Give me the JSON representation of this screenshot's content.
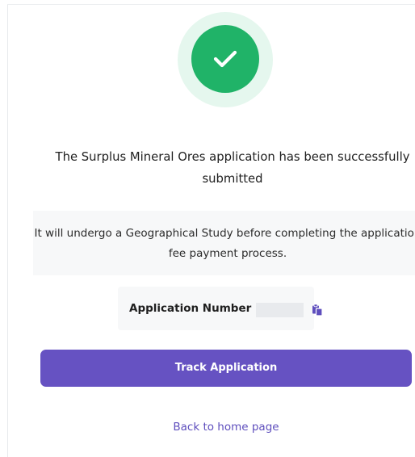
{
  "status_icon": {
    "icon": "check-circle-icon",
    "ring_color": "#e5f7ee",
    "circle_color": "#20b368",
    "check_color": "#ffffff"
  },
  "confirmation": {
    "heading": "The Surplus Mineral Ores application has been successfully submitted",
    "message": "It will undergo a Geographical Study before completing the application fee payment process."
  },
  "application": {
    "number_label": "Application Number",
    "number_value": "",
    "copy_icon": "copy-icon"
  },
  "actions": {
    "track_label": "Track Application",
    "back_label": "Back to home page",
    "primary_color": "#6652c2",
    "link_color": "#5e4ebd"
  }
}
